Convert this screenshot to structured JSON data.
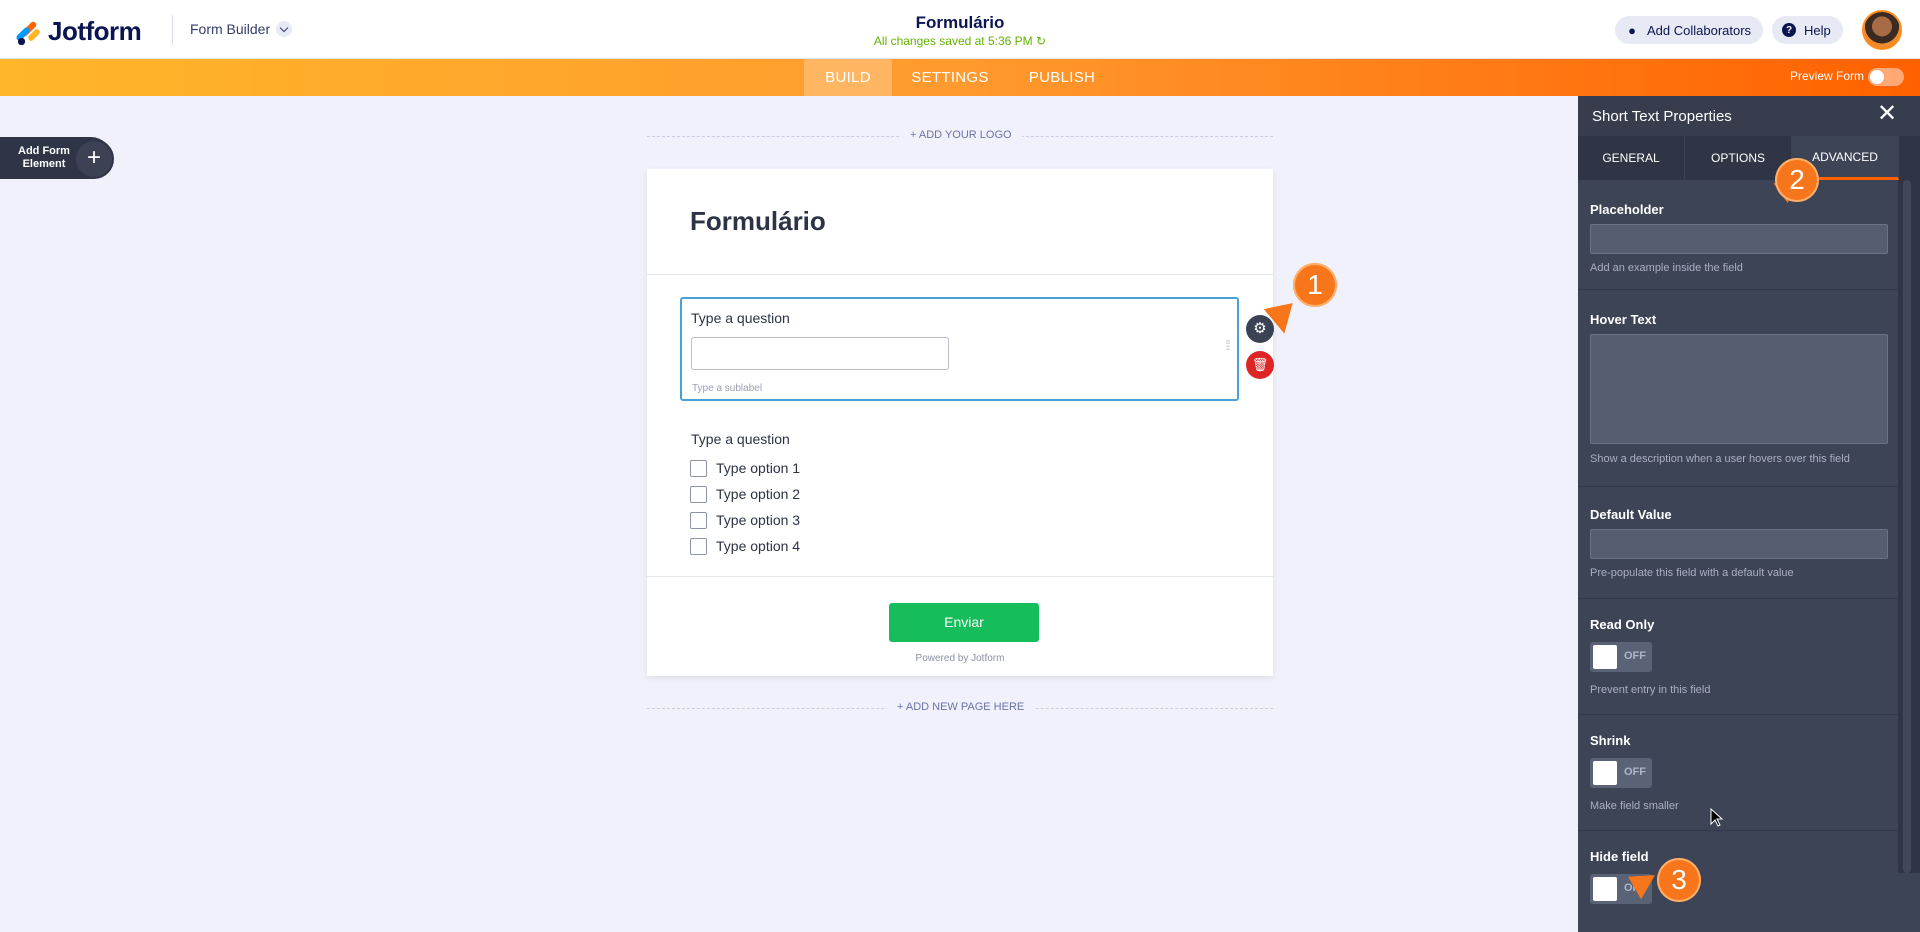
{
  "header": {
    "brand": "Jotform",
    "builder_menu": "Form Builder",
    "form_title": "Formulário",
    "save_status": "All changes saved at 5:36 PM",
    "add_collaborators": "Add Collaborators",
    "help": "Help"
  },
  "nav": {
    "tabs": [
      "BUILD",
      "SETTINGS",
      "PUBLISH"
    ],
    "active_tab": "BUILD",
    "preview_label": "Preview Form"
  },
  "canvas": {
    "add_element_label": "Add Form Element",
    "add_logo": "+ ADD YOUR LOGO",
    "add_page": "+ ADD NEW PAGE HERE",
    "form_heading": "Formulário",
    "q1_label": "Type a question",
    "q1_sublabel": "Type a sublabel",
    "q2_label": "Type a question",
    "options": [
      "Type option 1",
      "Type option 2",
      "Type option 3",
      "Type option 4"
    ],
    "submit_label": "Enviar",
    "powered_by": "Powered by Jotform"
  },
  "panel": {
    "title": "Short Text Properties",
    "tabs": [
      "GENERAL",
      "OPTIONS",
      "ADVANCED"
    ],
    "active_tab": "ADVANCED",
    "placeholder_title": "Placeholder",
    "placeholder_hint": "Add an example inside the field",
    "hover_title": "Hover Text",
    "hover_hint": "Show a description when a user hovers over this field",
    "default_title": "Default Value",
    "default_hint": "Pre-populate this field with a default value",
    "readonly_title": "Read Only",
    "readonly_hint": "Prevent entry in this field",
    "shrink_title": "Shrink",
    "shrink_hint": "Make field smaller",
    "hide_title": "Hide field",
    "toggle_off": "OFF"
  },
  "callouts": [
    "1",
    "2",
    "3"
  ],
  "colors": {
    "accent_orange": "#ff6100",
    "submit_green": "#18bd5b",
    "selected_border": "#4aa0d5",
    "panel_bg": "#3d4456"
  }
}
